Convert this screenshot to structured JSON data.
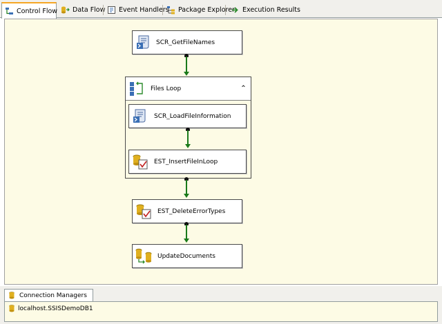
{
  "tabs": [
    {
      "label": "Control Flow",
      "icon": "control-flow-icon",
      "active": true
    },
    {
      "label": "Data Flow",
      "icon": "data-flow-icon",
      "active": false
    },
    {
      "label": "Event Handlers",
      "icon": "event-handlers-icon",
      "active": false
    },
    {
      "label": "Package Explorer",
      "icon": "package-explorer-icon",
      "active": false
    },
    {
      "label": "Execution Results",
      "icon": "execution-results-icon",
      "active": false
    }
  ],
  "tasks": {
    "get_file_names": {
      "label": "SCR_GetFileNames",
      "icon": "script-task-icon"
    },
    "files_loop": {
      "label": "Files Loop",
      "icon": "foreach-loop-icon",
      "collapse_glyph": "⌃"
    },
    "load_file_information": {
      "label": "SCR_LoadFileInformation",
      "icon": "script-task-icon"
    },
    "insert_file_in_loop": {
      "label": "EST_InsertFileInLoop",
      "icon": "execute-sql-task-icon"
    },
    "delete_error_types": {
      "label": "EST_DeleteErrorTypes",
      "icon": "execute-sql-task-icon"
    },
    "update_documents": {
      "label": "UpdateDocuments",
      "icon": "data-flow-task-icon"
    }
  },
  "connection_managers": {
    "tab_label": "Connection Managers",
    "items": [
      {
        "label": "localhost.SSISDemoDB1",
        "icon": "connection-icon"
      }
    ]
  },
  "colors": {
    "canvas_background": "#fdfbe5",
    "precedence_constraint": "#1a7a1a",
    "active_tab_accent": "#f5a623"
  }
}
